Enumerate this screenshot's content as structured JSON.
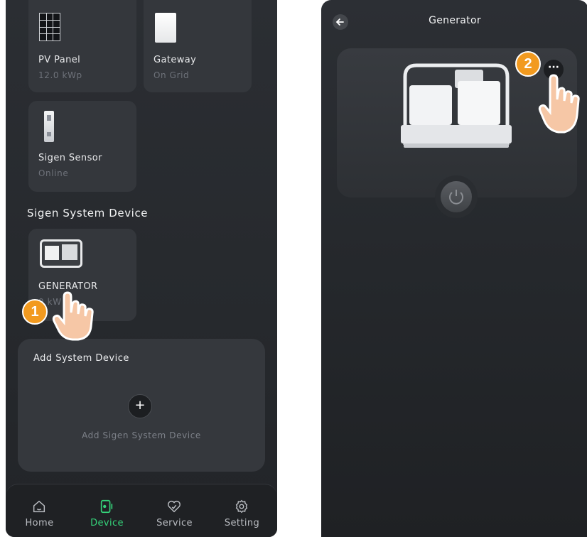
{
  "left_screen": {
    "cards": [
      {
        "name": "PV Panel",
        "status": "12.0 kWp",
        "icon": "solar-panel-icon"
      },
      {
        "name": "Gateway",
        "status": "On Grid",
        "icon": "gateway-icon"
      },
      {
        "name": "Sigen Sensor",
        "status": "Online",
        "icon": "sensor-icon"
      }
    ],
    "section_title": "Sigen System Device",
    "system_device": {
      "name": "GENERATOR",
      "status": "0 kW",
      "icon": "generator-icon"
    },
    "add_section": {
      "title": "Add System Device",
      "plus_symbol": "+",
      "add_label": "Add Sigen System Device"
    },
    "tabs": [
      {
        "label": "Home",
        "icon": "home-icon",
        "active": false
      },
      {
        "label": "Device",
        "icon": "device-icon",
        "active": true
      },
      {
        "label": "Service",
        "icon": "service-icon",
        "active": false
      },
      {
        "label": "Setting",
        "icon": "settings-icon",
        "active": false
      }
    ]
  },
  "right_screen": {
    "title": "Generator",
    "back_icon": "back-arrow-icon",
    "more_symbol": "···",
    "power_icon": "power-icon"
  },
  "annotations": {
    "step_1": "1",
    "step_2": "2"
  },
  "colors": {
    "accent_green": "#35d37a",
    "step_badge": "#f29a1f",
    "background": "#2a2d31"
  }
}
